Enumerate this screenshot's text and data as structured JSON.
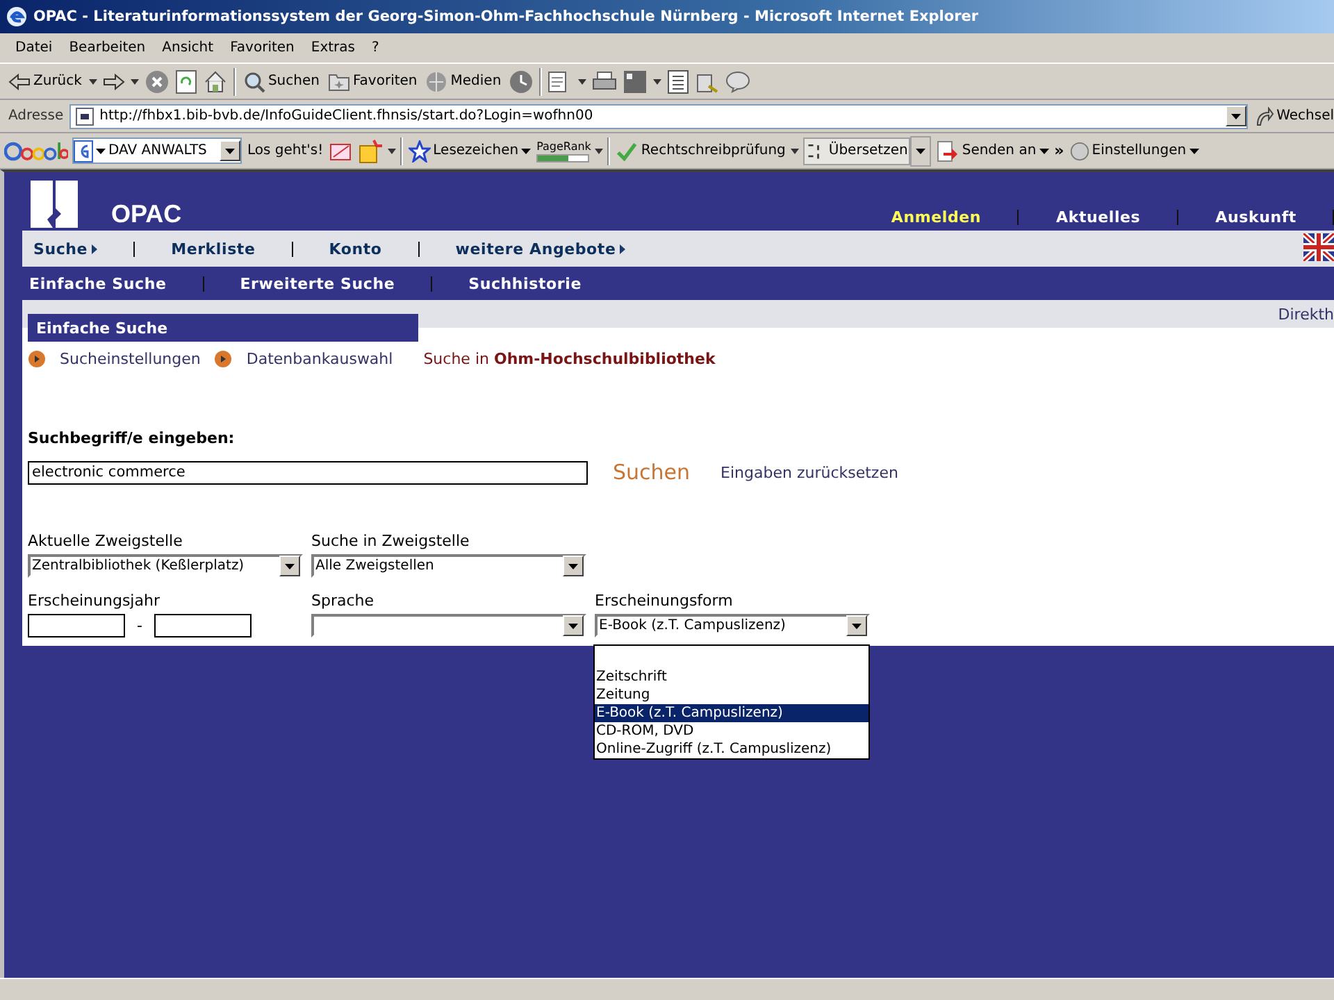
{
  "window": {
    "title": "OPAC - Literaturinformationssystem der Georg-Simon-Ohm-Fachhochschule Nürnberg - Microsoft Internet Explorer"
  },
  "menu_bar": [
    "Datei",
    "Bearbeiten",
    "Ansicht",
    "Favoriten",
    "Extras",
    "?"
  ],
  "toolbar": {
    "back": "Zurück",
    "search": "Suchen",
    "favorites": "Favoriten",
    "media": "Medien"
  },
  "address_bar": {
    "label": "Adresse",
    "url": "http://fhbx1.bib-bvb.de/InfoGuideClient.fhnsis/start.do?Login=wofhn00",
    "go": "Wechsel"
  },
  "google_toolbar": {
    "search_value": "DAV ANWALTS",
    "go": "Los geht's!",
    "bookmarks": "Lesezeichen",
    "pagerank": "PageRank",
    "spellcheck": "Rechtschreibprüfung",
    "translate": "Übersetzen",
    "send": "Senden an",
    "more": "»",
    "settings": "Einstellungen"
  },
  "page": {
    "logo_text": "OPAC",
    "top_links": [
      {
        "label": "Anmelden",
        "highlighted": true
      },
      {
        "label": "Aktuelles",
        "highlighted": false
      },
      {
        "label": "Auskunft",
        "highlighted": false
      }
    ],
    "main_nav": [
      {
        "label": "Suche",
        "has_submenu": true
      },
      {
        "label": "Merkliste",
        "has_submenu": false
      },
      {
        "label": "Konto",
        "has_submenu": false
      },
      {
        "label": "weitere Angebote",
        "has_submenu": true
      }
    ],
    "sub_nav": [
      {
        "label": "Einfache Suche"
      },
      {
        "label": "Erweiterte Suche"
      },
      {
        "label": "Suchhistorie"
      }
    ],
    "side_link": "Direkth",
    "panel_title": "Einfache Suche",
    "panel_links": [
      "Sucheinstellungen",
      "Datenbankauswahl"
    ],
    "scope": "Suche in **Ohm-Hochschulbibliothek**",
    "search_label": "Suchbegriff/e eingeben:",
    "search_value": "electronic commerce",
    "search_button": "Suchen",
    "reset_link": "Eingaben zurücksetzen",
    "branch": {
      "label": "Aktuelle Zweigstelle",
      "value": "Zentralbibliothek (Keßlerplatz)"
    },
    "search_branch": {
      "label": "Suche in Zweigstelle",
      "value": "Alle Zweigstellen"
    },
    "year": {
      "label": "Erscheinungsjahr",
      "separator": "-"
    },
    "language": {
      "label": "Sprache"
    },
    "form": {
      "label": "Erscheinungsform",
      "value": "E-Book (z.T. Campuslizenz)",
      "expanded": true,
      "options": [
        {
          "selected": false
        },
        {
          "label": "Zeitschrift",
          "selected": false
        },
        {
          "label": "Zeitung",
          "selected": false
        },
        {
          "label": "E-Book (z.T. Campuslizenz)",
          "selected": true
        },
        {
          "label": "CD-ROM, DVD",
          "selected": false
        },
        {
          "label": "Online-Zugriff (z.T. Campuslizenz)",
          "selected": false
        }
      ]
    }
  }
}
